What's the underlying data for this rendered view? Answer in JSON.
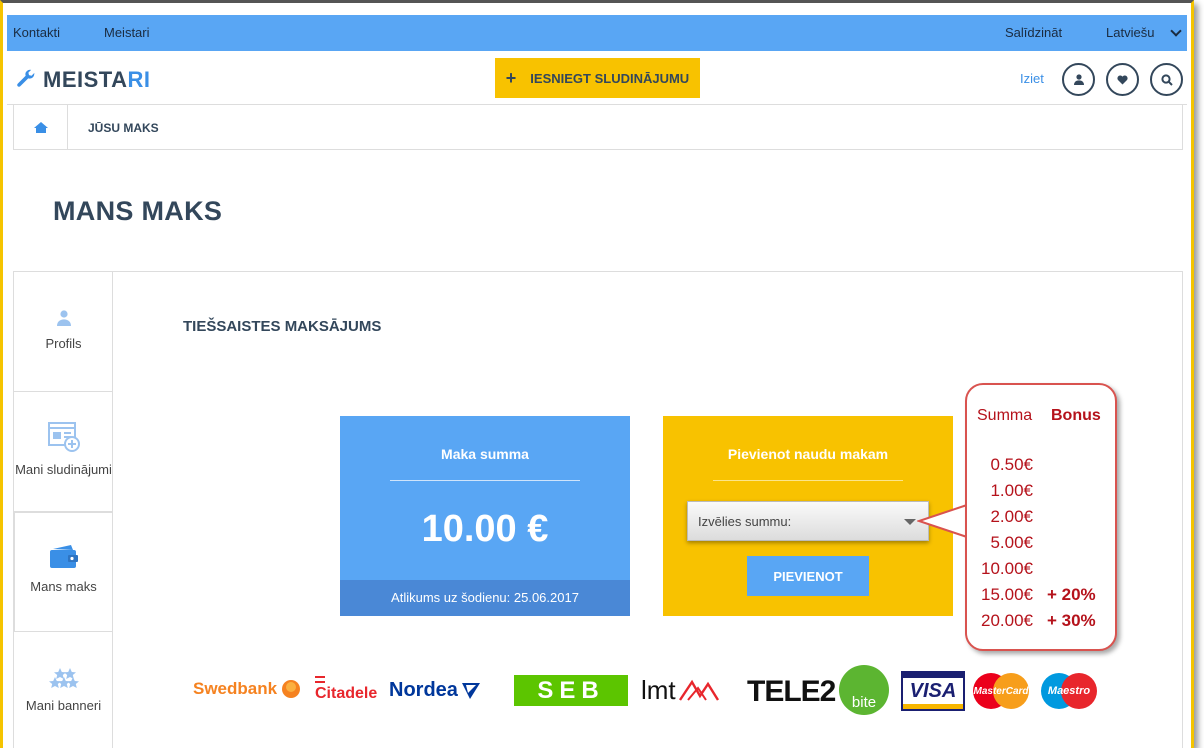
{
  "topbar": {
    "contacts": "Kontakti",
    "masters": "Meistari",
    "compare": "Salīdzināt",
    "language": "Latviešu"
  },
  "header": {
    "logo_main": "MEISTA",
    "logo_accent": "RI",
    "submit_label": "IESNIEGT SLUDINĀJUMU",
    "logout_label": "Iziet"
  },
  "breadcrumb": {
    "current": "JŪSU MAKS"
  },
  "page": {
    "title": "MANS MAKS",
    "section_title": "TIEŠSAISTES MAKSĀJUMS"
  },
  "sidebar": {
    "items": [
      {
        "label": "Profils",
        "icon": "user-icon"
      },
      {
        "label": "Mani sludinājumi",
        "icon": "ads-icon"
      },
      {
        "label": "Mans maks",
        "icon": "wallet-icon"
      },
      {
        "label": "Mani banneri",
        "icon": "stars-icon"
      }
    ]
  },
  "wallet": {
    "label": "Maka summa",
    "amount": "10.00 €",
    "balance_note": "Atlikums uz šodienu: 25.06.2017"
  },
  "add_funds": {
    "label": "Pievienot naudu makam",
    "select_placeholder": "Izvēlies summu:",
    "button_label": "PIEVIENOT"
  },
  "callout": {
    "header_sum": "Summa",
    "header_bonus": "Bonus",
    "rows": [
      {
        "sum": "0.50€",
        "bonus": ""
      },
      {
        "sum": "1.00€",
        "bonus": ""
      },
      {
        "sum": "2.00€",
        "bonus": ""
      },
      {
        "sum": "5.00€",
        "bonus": ""
      },
      {
        "sum": "10.00€",
        "bonus": ""
      },
      {
        "sum": "15.00€",
        "bonus": "+ 20%"
      },
      {
        "sum": "20.00€",
        "bonus": "+ 30%"
      }
    ]
  },
  "payment_logos": {
    "swedbank": "Swedbank",
    "citadele": "Citadele",
    "nordea": "Nordea",
    "seb": "SEB",
    "lmt": "lmt",
    "tele2": "TELE2",
    "bite": "bite",
    "visa": "VISA",
    "mastercard": "MasterCard",
    "maestro": "Maestro"
  },
  "colors": {
    "accent_blue": "#59a6f4",
    "accent_yellow": "#f8c200",
    "text_dark": "#33475b",
    "callout_red": "#b5121b"
  }
}
